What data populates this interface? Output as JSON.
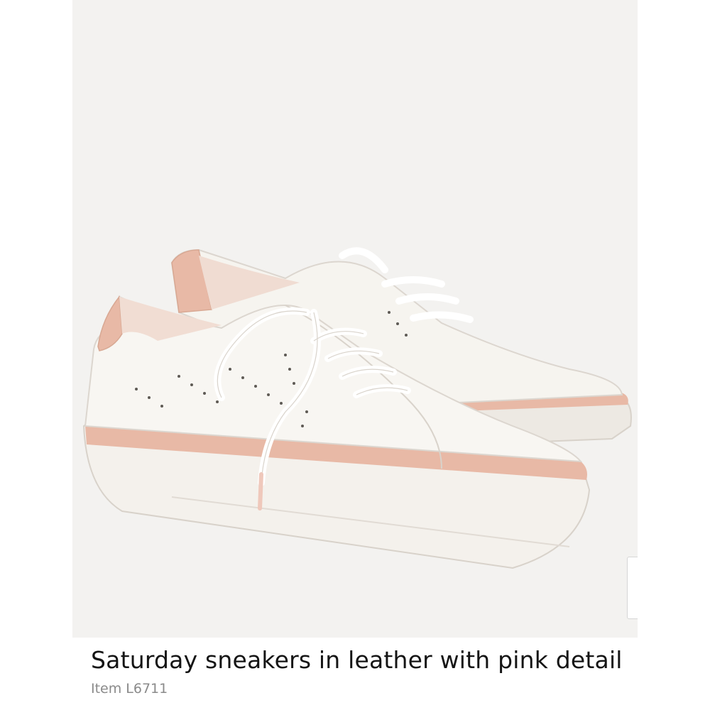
{
  "product": {
    "title": "Saturday sneakers in leather with pink detail",
    "item_label": "Item",
    "item_number": "L6711"
  },
  "image": {
    "subject": "pair of white leather sneakers with pink heel tab and pink sole stripe"
  },
  "controls": {
    "expand_icon": "expand-arrows-icon"
  },
  "colors": {
    "photo_background": "#f3f2f0",
    "leather_white": "#f6f4ef",
    "pink_accent": "#e8b9a6",
    "title_text": "#141414",
    "secondary_text": "#8a8a8a"
  }
}
